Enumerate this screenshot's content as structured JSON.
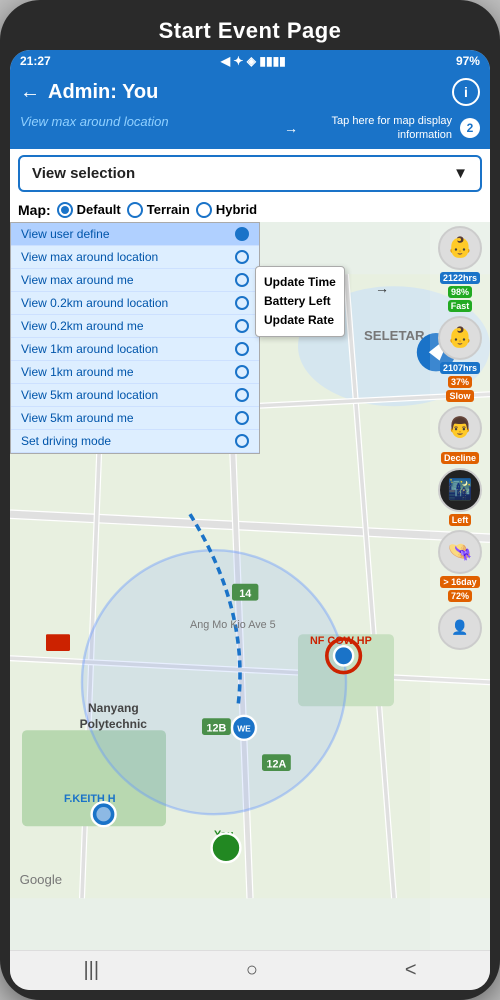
{
  "phone": {
    "title": "Start Event Page",
    "status": {
      "time": "21:27",
      "battery": "97%",
      "signal_icon": "▼",
      "network": "◈ ◉ ▮▮▮▮"
    },
    "header": {
      "back_label": "←",
      "title": "Admin: You",
      "info_label": "i",
      "view_max_label": "View max around location",
      "tap_hint": "Tap here for map display information",
      "badge": "2"
    },
    "dropdown": {
      "label": "View selection",
      "arrow": "▼",
      "items": [
        {
          "label": "View user define",
          "selected": true
        },
        {
          "label": "View max around location",
          "selected": false
        },
        {
          "label": "View max around me",
          "selected": false
        },
        {
          "label": "View 0.2km around location",
          "selected": false
        },
        {
          "label": "View 0.2km around me",
          "selected": false
        },
        {
          "label": "View 1km around location",
          "selected": false
        },
        {
          "label": "View 1km around me",
          "selected": false
        },
        {
          "label": "View 5km around location",
          "selected": false
        },
        {
          "label": "View 5km around me",
          "selected": false
        },
        {
          "label": "Set driving mode",
          "selected": false
        }
      ]
    },
    "map_types": {
      "label": "Map:",
      "options": [
        {
          "label": "Default",
          "selected": true
        },
        {
          "label": "Terrain",
          "selected": false
        },
        {
          "label": "Hybrid",
          "selected": false
        }
      ]
    },
    "tooltip": {
      "line1": "Update Time",
      "line2": "Battery Left",
      "line3": "Update Rate"
    },
    "map_labels": {
      "seletar": "SELETAR",
      "nanyang": "Nanyang\nPolytechnic",
      "google": "Google",
      "f_keith": "F.KEITH H",
      "you_label": "You",
      "nf_cow": "NF COW HP",
      "ang_mo_kio": "Ang Mo Kio Ave 5"
    },
    "users": [
      {
        "id": "user1",
        "avatar_emoji": "👶",
        "badges": [
          "2122hrs",
          "98%",
          "Fast"
        ],
        "badge_colors": [
          "blue",
          "green",
          "green"
        ]
      },
      {
        "id": "user2",
        "avatar_emoji": "👶",
        "badges": [
          "2107hrs",
          "37%",
          "Slow"
        ],
        "badge_colors": [
          "blue",
          "orange",
          "orange"
        ]
      },
      {
        "id": "user3",
        "avatar_emoji": "👨",
        "badges": [
          "Decline"
        ],
        "badge_colors": [
          "orange"
        ]
      },
      {
        "id": "user4",
        "avatar_emoji": "🌃",
        "badges": [
          "Left"
        ],
        "badge_colors": [
          "orange"
        ]
      },
      {
        "id": "user5",
        "avatar_emoji": "👒",
        "badges": [
          "> 16day",
          "72%"
        ],
        "badge_colors": [
          "orange",
          "orange"
        ]
      },
      {
        "id": "user6",
        "avatar_emoji": "👤",
        "badges": [],
        "badge_colors": []
      }
    ],
    "nav": {
      "menu_icon": "|||",
      "home_icon": "○",
      "back_icon": "<"
    }
  }
}
